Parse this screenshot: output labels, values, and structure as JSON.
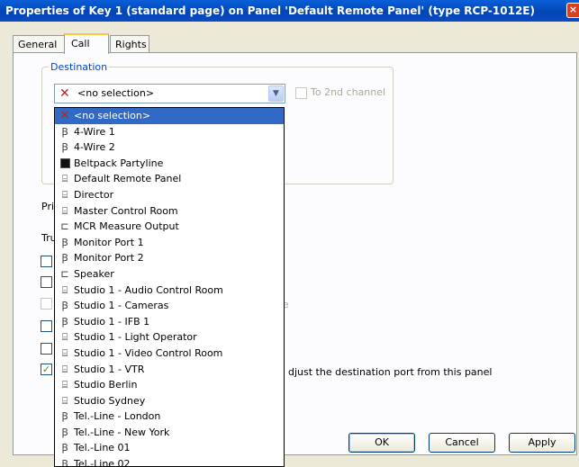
{
  "window": {
    "title": "Properties of Key 1 (standard page) on Panel 'Default Remote Panel' (type RCP-1012E)",
    "close_glyph": "×"
  },
  "tabs": [
    {
      "label": "General"
    },
    {
      "label": "Call",
      "active": true
    },
    {
      "label": "Rights"
    }
  ],
  "destination": {
    "group_label": "Destination",
    "selected_value": "<no selection>",
    "second_channel_label": "To 2nd channel"
  },
  "partial_labels": {
    "pri": "Pri",
    "tru": "Tru",
    "trailing_e": "e",
    "adjust_text": "djust the destination port from this panel"
  },
  "dropdown": {
    "items": [
      {
        "label": "<no selection>",
        "icon": "x-icon",
        "selected": true
      },
      {
        "label": "4-Wire 1",
        "icon": "port-icon"
      },
      {
        "label": "4-Wire 2",
        "icon": "port-icon"
      },
      {
        "label": "Beltpack Partyline",
        "icon": "partyline-icon"
      },
      {
        "label": "Default Remote Panel",
        "icon": "panel-icon"
      },
      {
        "label": "Director",
        "icon": "panel-icon"
      },
      {
        "label": "Master Control Room",
        "icon": "panel-icon"
      },
      {
        "label": "MCR Measure Output",
        "icon": "speaker-icon"
      },
      {
        "label": "Monitor Port 1",
        "icon": "port-icon"
      },
      {
        "label": "Monitor Port 2",
        "icon": "port-icon"
      },
      {
        "label": "Speaker",
        "icon": "speaker-icon"
      },
      {
        "label": "Studio 1 - Audio Control Room",
        "icon": "panel-icon"
      },
      {
        "label": "Studio 1 - Cameras",
        "icon": "port-icon"
      },
      {
        "label": "Studio 1 - IFB 1",
        "icon": "port-icon"
      },
      {
        "label": "Studio 1 - Light Operator",
        "icon": "panel-icon"
      },
      {
        "label": "Studio 1 - Video Control Room",
        "icon": "panel-icon"
      },
      {
        "label": "Studio 1 - VTR",
        "icon": "panel-icon"
      },
      {
        "label": "Studio Berlin",
        "icon": "panel-icon"
      },
      {
        "label": "Studio Sydney",
        "icon": "panel-icon"
      },
      {
        "label": "Tel.-Line - London",
        "icon": "port-icon"
      },
      {
        "label": "Tel.-Line - New York",
        "icon": "port-icon"
      },
      {
        "label": "Tel.-Line 01",
        "icon": "port-icon"
      },
      {
        "label": "Tel.-Line 02",
        "icon": "port-icon"
      }
    ]
  },
  "buttons": {
    "ok": "OK",
    "cancel": "Cancel",
    "apply": "Apply"
  },
  "colors": {
    "titlebar": "#0246b5",
    "selection": "#316ac5",
    "group_title": "#0046d5"
  }
}
